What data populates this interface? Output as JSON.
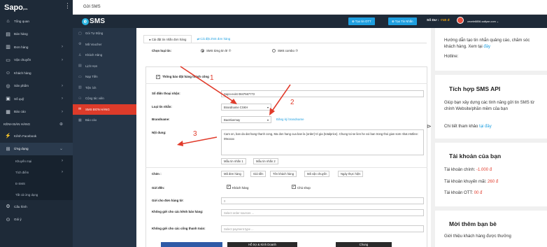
{
  "nav": {
    "logo": "Sapo",
    "logo_sub": "pos",
    "items": [
      {
        "label": "Tổng quan",
        "icon": "home-icon"
      },
      {
        "label": "Bán hàng",
        "icon": "cart-icon"
      },
      {
        "label": "Đơn hàng",
        "icon": "order-icon"
      },
      {
        "label": "Vận chuyển",
        "icon": "truck-icon"
      },
      {
        "label": "Khách hàng",
        "icon": "user-icon"
      },
      {
        "label": "Sản phẩm",
        "icon": "product-icon"
      },
      {
        "label": "Số quỹ",
        "icon": "wallet-icon"
      },
      {
        "label": "Báo cáo",
        "icon": "report-icon"
      },
      {
        "label": "KÊNH BÁN HÀNG",
        "icon": "plus-icon"
      },
      {
        "label": "Kênh Facebook",
        "icon": "facebook-icon"
      },
      {
        "label": "Ứng dụng",
        "icon": "apps-icon"
      },
      {
        "label": "Khuyến mại"
      },
      {
        "label": "Tích điểm"
      },
      {
        "label": "E-SMS"
      },
      {
        "label": "Tất cả ứng dụng"
      },
      {
        "label": "Cấu hình",
        "icon": "settings-icon"
      },
      {
        "label": "Gói ý",
        "icon": "gift-icon"
      }
    ]
  },
  "header": {
    "title": "Gửi SMS"
  },
  "brand": {
    "logo": "SMS",
    "logo_mark": "e"
  },
  "top_buttons": {
    "create_ott": "⊕ Tạo tin OTT",
    "create_message": "⊕ Tạo Tin Nhắn",
    "balance_label": "Số Dư :",
    "balance_value": "-740 đ",
    "email": "cecele8856-sallyse-com"
  },
  "sms_menu": [
    {
      "label": "Gói Tự Động",
      "icon": "doc-icon"
    },
    {
      "label": "Mã Voucher",
      "icon": "gear-icon"
    },
    {
      "label": "Khách Hàng",
      "icon": "users-icon"
    },
    {
      "label": "Lịch Hẹn",
      "icon": "calendar-icon"
    },
    {
      "label": "Nạp Tiền",
      "icon": "card-icon"
    },
    {
      "label": "Tiện ích",
      "icon": "tool-icon"
    },
    {
      "label": "Cộng tác viên",
      "icon": "people-icon"
    },
    {
      "label": "SMS ĐƠN HÀNG",
      "icon": "sms-icon"
    },
    {
      "label": "Báo cáo",
      "icon": "report-icon"
    }
  ],
  "form": {
    "tab_active": "● Cài đặt tin nhắn đơn hàng",
    "tab_other": "⇄ Cài đặt ZNS đơn hàng",
    "choose_type_label": "Chọn loại tin:",
    "radio_single": "SMS từng tin lẻ ⑦",
    "radio_combo": "SMS combo ⑦",
    "notify_checkbox": "Thông báo đặt hàng thành công",
    "phone_label": "Số điện thoại nhận:",
    "phone_value": "Sapo-exist 0847567772",
    "msg_type_label": "Loại tin nhắn:",
    "msg_type_value": "Brandname CSKH",
    "brandname_label": "Brandname:",
    "brandname_value": "Baotrixemay",
    "brandname_link": "Đăng ký brandname",
    "content_label": "Nội dung:",
    "content_value": "Cam on, ban da dat hang thanh cong, Ma don hang cua ban la {order} tri gia {totalprice}. Chung toi se lien he voi ban trong thoi gian som nhat.Hotline: 09xxxxx",
    "template1": "Mẫu tin nhắn 1",
    "template2": "Mẫu tin nhắn 2",
    "insert_label": "Chèn :",
    "insert_chips": [
      "Mã đơn hàng",
      "Giá tiền",
      "Tên khách hàng",
      "Mã vận chuyển",
      "Ngày thực hiện"
    ],
    "send_to_label": "Gửi đến:",
    "send_customer": "Khách hàng",
    "send_shop": "Chủ shop",
    "send_from_label": "Gửi cho đơn hàng từ:",
    "send_from_value": "0",
    "channel_label": "Không gửi cho các kênh bán hàng:",
    "channel_placeholder": "Select order sources ...",
    "gateway_label": "Không gửi cho các cổng thanh toán:",
    "gateway_placeholder": "Select payment type ...",
    "annotations": [
      "1",
      "2",
      "3"
    ]
  },
  "bottom": {
    "b1": "Hỗ trợ & Kinh Doanh",
    "b2": "Chung"
  },
  "right": {
    "guide_text": "Hướng dẫn tạo tin nhắn quảng cáo, chăm sóc khách hàng. Xem tại",
    "guide_link": "đây",
    "hotline": "Hotline:",
    "api_title": "Tích hợp SMS API",
    "api_text": "Giúp bạn xây dựng các tính năng gửi tin SMS từ chính Website/phần mềm của bạn",
    "api_detail": "Chi tiết tham khảo",
    "api_link": "tại đây",
    "account_title": "Tài khoản của bạn",
    "main_label": "Tài khoản chính:",
    "main_value": "-1.000 đ",
    "promo_label": "Tài khoản khuyến mãi:",
    "promo_value": "260 đ",
    "ott_label": "Tài khoản OTT:",
    "ott_value": "00 đ",
    "invite_title": "Mời thêm bạn bè",
    "invite_text": "Giới thiệu khách hàng được thưởng"
  }
}
